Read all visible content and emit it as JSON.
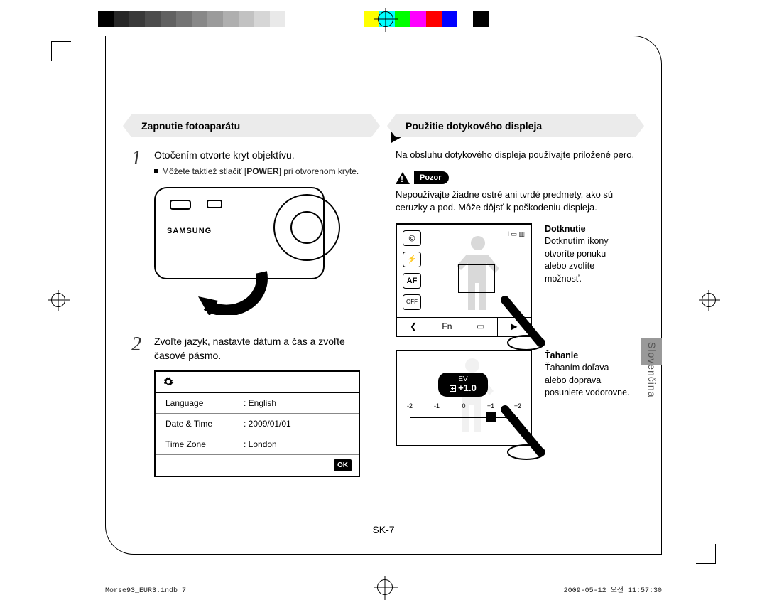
{
  "color_bar": [
    "#000000",
    "#272727",
    "#3a3a3a",
    "#4d4d4d",
    "#616161",
    "#747474",
    "#888888",
    "#9b9b9b",
    "#afafaf",
    "#c2c2c2",
    "#d6d6d6",
    "#e9e9e9",
    "#ffffff",
    "#ffffff",
    "#ffffff",
    "#ffffff",
    "#ffffff",
    "#ffff00",
    "#00ffff",
    "#00ff00",
    "#ff00ff",
    "#ff0000",
    "#0000ff",
    "#ffffff",
    "#000000"
  ],
  "left": {
    "ribbon_title": "Zapnutie fotoaparátu",
    "step1_num": "1",
    "step1_title": "Otočením otvorte kryt objektívu.",
    "step1_bullet_pre": "Môžete taktiež stlačiť [",
    "step1_bullet_bold": "POWER",
    "step1_bullet_post": "] pri otvorenom kryte.",
    "camera_brand": "SAMSUNG",
    "step2_num": "2",
    "step2_title": "Zvoľte jazyk, nastavte dátum a čas a zvoľte časové pásmo.",
    "menu": {
      "rows": [
        {
          "k": "Language",
          "v": ": English"
        },
        {
          "k": "Date & Time",
          "v": ": 2009/01/01"
        },
        {
          "k": "Time Zone",
          "v": ": London"
        }
      ],
      "ok": "OK"
    }
  },
  "right": {
    "ribbon_title": "Použitie dotykového displeja",
    "intro": "Na obsluhu dotykového displeja používajte priložené pero.",
    "warn_label": "Pozor",
    "warn_text": "Nepoužívajte žiadne ostré ani tvrdé predmety, ako sú ceruzky a pod. Môže dôjsť k poškodeniu displeja.",
    "touch": {
      "title": "Dotknutie",
      "text": "Dotknutím ikony otvoríte ponuku alebo zvolíte možnosť.",
      "af": "AF",
      "off": "OFF",
      "bar": {
        "back": "❮",
        "fn": "Fn",
        "disp": "▭",
        "play": "▶"
      },
      "top_ind": "I ▭ ▥"
    },
    "drag": {
      "title": "Ťahanie",
      "text": "Ťahaním doľava alebo doprava posuniete vodorovne.",
      "ev_label": "EV",
      "ev_value": "+1.0",
      "ticks": [
        "-2",
        "-1",
        "0",
        "+1",
        "+2"
      ]
    }
  },
  "page_number": "SK-7",
  "lang_tab": "Slovenčina",
  "imprint_left": "Morse93_EUR3.indb   7",
  "imprint_right": "2009-05-12   오전 11:57:30"
}
